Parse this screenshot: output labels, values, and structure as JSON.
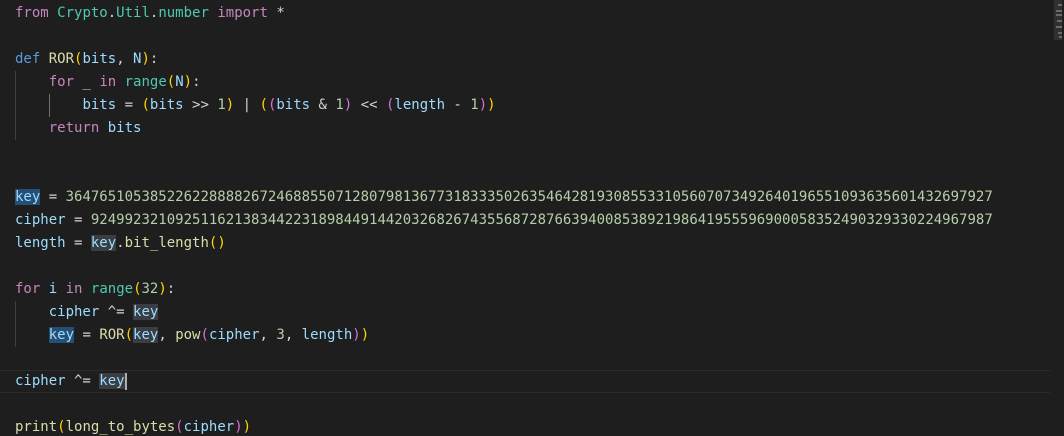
{
  "editor": {
    "lines": [
      {
        "name": "line-import",
        "tokens": [
          {
            "t": "from",
            "c": "kw2"
          },
          {
            "t": " "
          },
          {
            "t": "Crypto",
            "c": "cls"
          },
          {
            "t": "."
          },
          {
            "t": "Util",
            "c": "cls"
          },
          {
            "t": "."
          },
          {
            "t": "number",
            "c": "cls"
          },
          {
            "t": " "
          },
          {
            "t": "import",
            "c": "kw2"
          },
          {
            "t": " *"
          }
        ]
      },
      {
        "name": "line-blank",
        "tokens": []
      },
      {
        "name": "line-def-ror",
        "tokens": [
          {
            "t": "def",
            "c": "kw"
          },
          {
            "t": " "
          },
          {
            "t": "ROR",
            "c": "fn"
          },
          {
            "t": "(",
            "c": "b1"
          },
          {
            "t": "bits",
            "c": "var"
          },
          {
            "t": ", "
          },
          {
            "t": "N",
            "c": "var"
          },
          {
            "t": ")",
            "c": "b1"
          },
          {
            "t": ":"
          }
        ]
      },
      {
        "name": "line-for-range",
        "indent": 1,
        "tokens": [
          {
            "t": "for",
            "c": "kw2"
          },
          {
            "t": " "
          },
          {
            "t": "_",
            "c": "var"
          },
          {
            "t": " "
          },
          {
            "t": "in",
            "c": "kw2"
          },
          {
            "t": " "
          },
          {
            "t": "range",
            "c": "cls"
          },
          {
            "t": "(",
            "c": "b1"
          },
          {
            "t": "N",
            "c": "var"
          },
          {
            "t": ")",
            "c": "b1"
          },
          {
            "t": ":"
          }
        ]
      },
      {
        "name": "line-bits-assign",
        "indent": 2,
        "activeGuide": true,
        "tokens": [
          {
            "t": "bits",
            "c": "var"
          },
          {
            "t": " = "
          },
          {
            "t": "(",
            "c": "b1"
          },
          {
            "t": "bits",
            "c": "var"
          },
          {
            "t": " >> "
          },
          {
            "t": "1",
            "c": "num"
          },
          {
            "t": ")",
            "c": "b1"
          },
          {
            "t": " | "
          },
          {
            "t": "(",
            "c": "b1"
          },
          {
            "t": "(",
            "c": "b2"
          },
          {
            "t": "bits",
            "c": "var"
          },
          {
            "t": " & "
          },
          {
            "t": "1",
            "c": "num"
          },
          {
            "t": ")",
            "c": "b2"
          },
          {
            "t": " << "
          },
          {
            "t": "(",
            "c": "b2"
          },
          {
            "t": "length",
            "c": "var"
          },
          {
            "t": " - "
          },
          {
            "t": "1",
            "c": "num"
          },
          {
            "t": ")",
            "c": "b2"
          },
          {
            "t": ")",
            "c": "b1"
          }
        ]
      },
      {
        "name": "line-return-bits",
        "indent": 1,
        "tokens": [
          {
            "t": "return",
            "c": "kw2"
          },
          {
            "t": " "
          },
          {
            "t": "bits",
            "c": "var"
          }
        ]
      },
      {
        "name": "line-blank",
        "tokens": []
      },
      {
        "name": "line-blank",
        "tokens": []
      },
      {
        "name": "line-key-assign",
        "tokens": [
          {
            "t": "key",
            "c": "var",
            "h": "hl"
          },
          {
            "t": " = "
          },
          {
            "t": "36476510538522622888826724688550712807981367731833350263546428193085533105607073492640196551093635601432697927",
            "c": "num"
          }
        ]
      },
      {
        "name": "line-cipher-assign",
        "tokens": [
          {
            "t": "cipher",
            "c": "var"
          },
          {
            "t": " = "
          },
          {
            "t": "92499232109251162138344223189844914420326826743556872876639400853892198641955596900058352490329330224967987",
            "c": "num"
          }
        ]
      },
      {
        "name": "line-length-assign",
        "tokens": [
          {
            "t": "length",
            "c": "var"
          },
          {
            "t": " = "
          },
          {
            "t": "key",
            "c": "var",
            "h": "hl2"
          },
          {
            "t": "."
          },
          {
            "t": "bit_length",
            "c": "fn"
          },
          {
            "t": "(",
            "c": "b1"
          },
          {
            "t": ")",
            "c": "b1"
          }
        ]
      },
      {
        "name": "line-blank",
        "tokens": []
      },
      {
        "name": "line-for-32",
        "tokens": [
          {
            "t": "for",
            "c": "kw2"
          },
          {
            "t": " "
          },
          {
            "t": "i",
            "c": "var"
          },
          {
            "t": " "
          },
          {
            "t": "in",
            "c": "kw2"
          },
          {
            "t": " "
          },
          {
            "t": "range",
            "c": "cls"
          },
          {
            "t": "(",
            "c": "b1"
          },
          {
            "t": "32",
            "c": "num"
          },
          {
            "t": ")",
            "c": "b1"
          },
          {
            "t": ":"
          }
        ]
      },
      {
        "name": "line-cipher-xor",
        "indent": 1,
        "tokens": [
          {
            "t": "cipher",
            "c": "var"
          },
          {
            "t": " ^= "
          },
          {
            "t": "key",
            "c": "var",
            "h": "hl2"
          }
        ]
      },
      {
        "name": "line-key-ror",
        "indent": 1,
        "tokens": [
          {
            "t": "key",
            "c": "var",
            "h": "hl"
          },
          {
            "t": " = "
          },
          {
            "t": "ROR",
            "c": "fn"
          },
          {
            "t": "(",
            "c": "b1"
          },
          {
            "t": "key",
            "c": "var",
            "h": "hl2"
          },
          {
            "t": ", "
          },
          {
            "t": "pow",
            "c": "fn"
          },
          {
            "t": "(",
            "c": "b2"
          },
          {
            "t": "cipher",
            "c": "var"
          },
          {
            "t": ", "
          },
          {
            "t": "3",
            "c": "num"
          },
          {
            "t": ", "
          },
          {
            "t": "length",
            "c": "var"
          },
          {
            "t": ")",
            "c": "b2"
          },
          {
            "t": ")",
            "c": "b1"
          }
        ]
      },
      {
        "name": "line-blank",
        "tokens": []
      },
      {
        "name": "line-cipher-xor-final",
        "current": true,
        "cursorAfter": true,
        "tokens": [
          {
            "t": "cipher",
            "c": "var"
          },
          {
            "t": " ^= "
          },
          {
            "t": "key",
            "c": "var",
            "h": "hl2"
          }
        ]
      },
      {
        "name": "line-blank",
        "tokens": []
      },
      {
        "name": "line-print",
        "tokens": [
          {
            "t": "print",
            "c": "fn"
          },
          {
            "t": "(",
            "c": "b1"
          },
          {
            "t": "long_to_bytes",
            "c": "fn"
          },
          {
            "t": "(",
            "c": "b2"
          },
          {
            "t": "cipher",
            "c": "var"
          },
          {
            "t": ")",
            "c": "b2"
          },
          {
            "t": ")",
            "c": "b1"
          }
        ]
      }
    ]
  }
}
